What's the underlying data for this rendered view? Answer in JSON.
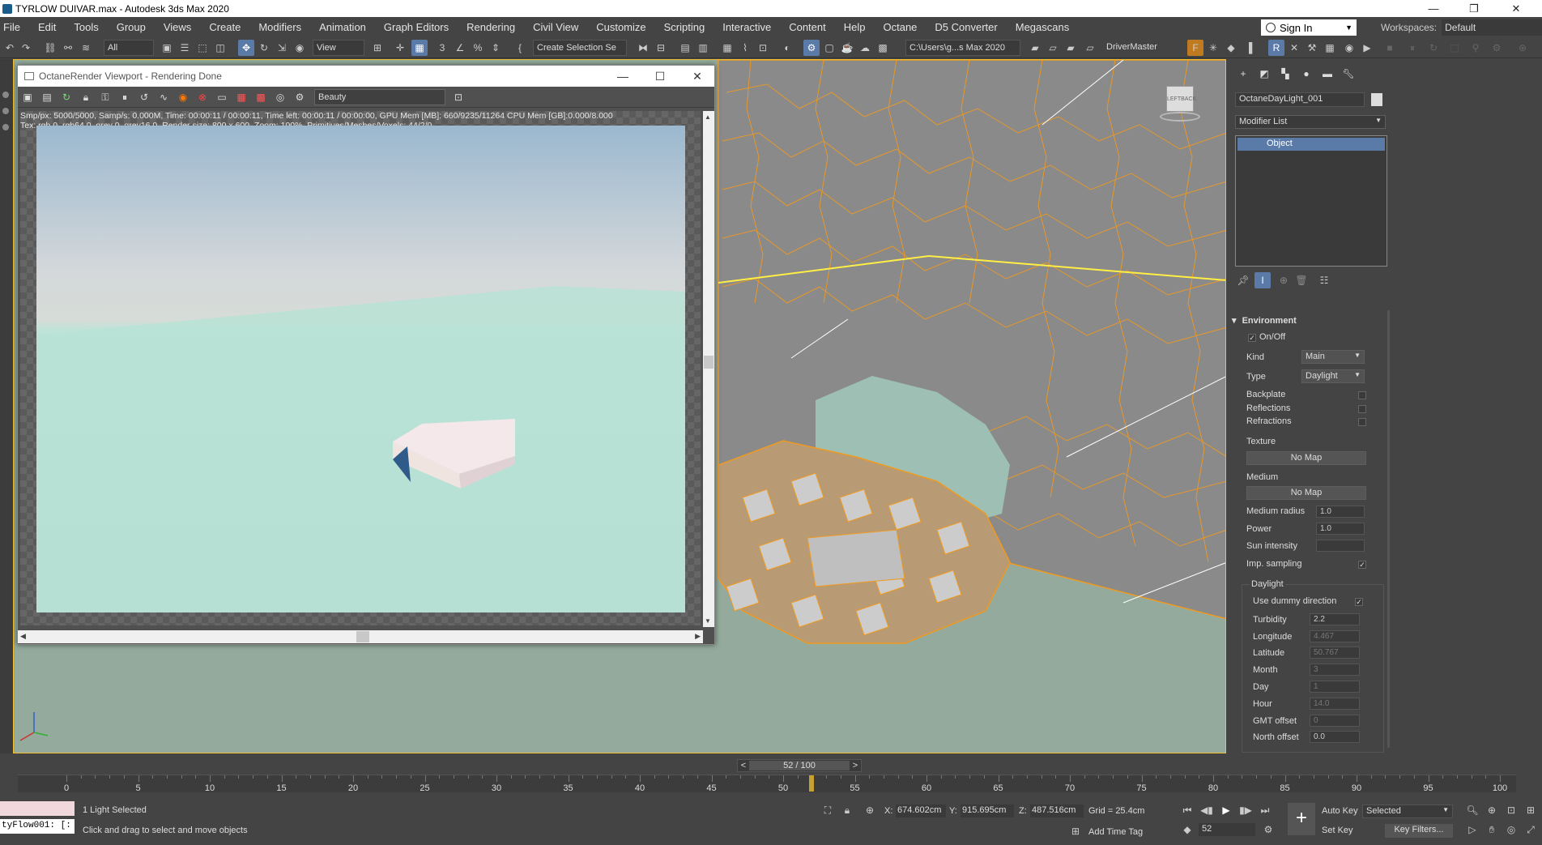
{
  "app": {
    "title": "TYRLOW DUIVAR.max - Autodesk 3ds Max 2020"
  },
  "menu": [
    "File",
    "Edit",
    "Tools",
    "Group",
    "Views",
    "Create",
    "Modifiers",
    "Animation",
    "Graph Editors",
    "Rendering",
    "Civil View",
    "Customize",
    "Scripting",
    "Interactive",
    "Content",
    "Help",
    "Octane",
    "D5 Converter",
    "Megascans"
  ],
  "account": {
    "signin": "Sign In",
    "workspaces_label": "Workspaces:",
    "workspace": "Default"
  },
  "toolbar": {
    "filter": "All",
    "ref_coord": "View",
    "selection_set": "Create Selection Se",
    "project_path": "C:\\Users\\g...s Max 2020",
    "driver": "DriverMaster"
  },
  "octane": {
    "title": "OctaneRender Viewport - Rendering Done",
    "pass": "Beauty",
    "stats_line1": "Smp/px: 5000/5000,   Samp/s: 0.000M,   Time: 00:00:11 / 00:00:11,   Time left: 00:00:11 / 00:00:00,   GPU Mem [MB]: 660/9235/11264   CPU Mem [GB]:0.000/8.000",
    "stats_line2": "Tex: rgb 0, rgb64 0, grey 0, grey16 0,   Render size: 800 x 600,   Zoom: 100%,   Primitives/Meshes/Voxels: 44/2/0"
  },
  "viewcube": {
    "left": "LEFT",
    "back": "BACK"
  },
  "command_panel": {
    "object_name": "OctaneDayLight_001",
    "modifier_list": "Modifier List",
    "stack_item": "Object",
    "section": "Environment",
    "onoff": "On/Off",
    "kind_label": "Kind",
    "kind": "Main",
    "type_label": "Type",
    "type": "Daylight",
    "backplate": "Backplate",
    "reflections": "Reflections",
    "refractions": "Refractions",
    "texture_label": "Texture",
    "texture_map": "No Map",
    "medium_label": "Medium",
    "medium_map": "No Map",
    "medium_radius_label": "Medium radius",
    "medium_radius": "1.0",
    "power_label": "Power",
    "power": "1.0",
    "sun_intensity_label": "Sun intensity",
    "sun_intensity": "",
    "imp_sampling_label": "Imp. sampling",
    "daylight_group": "Daylight",
    "use_dummy": "Use dummy direction",
    "turbidity_label": "Turbidity",
    "turbidity": "2.2",
    "longitude_label": "Longitude",
    "longitude": "4.467",
    "latitude_label": "Latitude",
    "latitude": "50.767",
    "month_label": "Month",
    "month": "3",
    "day_label": "Day",
    "day": "1",
    "hour_label": "Hour",
    "hour": "14.0",
    "gmt_label": "GMT offset",
    "gmt": "0",
    "north_label": "North offset",
    "north": "0.0"
  },
  "timeline": {
    "frame_display": "52 / 100",
    "current_frame": 52,
    "ticks": [
      "0",
      "5",
      "10",
      "15",
      "20",
      "25",
      "30",
      "35",
      "40",
      "45",
      "50",
      "55",
      "60",
      "65",
      "70",
      "75",
      "80",
      "85",
      "90",
      "95",
      "100"
    ]
  },
  "status": {
    "maxscript": "tyFlow001: [:",
    "selection": "1 Light Selected",
    "prompt": "Click and drag to select and move objects",
    "x_label": "X:",
    "x": "674.602cm",
    "y_label": "Y:",
    "y": "915.695cm",
    "z_label": "Z:",
    "z": "487.516cm",
    "grid": "Grid = 25.4cm",
    "add_time_tag": "Add Time Tag",
    "auto_key": "Auto Key",
    "set_key": "Set Key",
    "key_mode": "Selected",
    "key_filters": "Key Filters...",
    "frame_field": "52"
  },
  "colors": {
    "accent": "#5a7aa8",
    "selection": "#f09a20",
    "viewport_bg": "#93aa9c"
  }
}
